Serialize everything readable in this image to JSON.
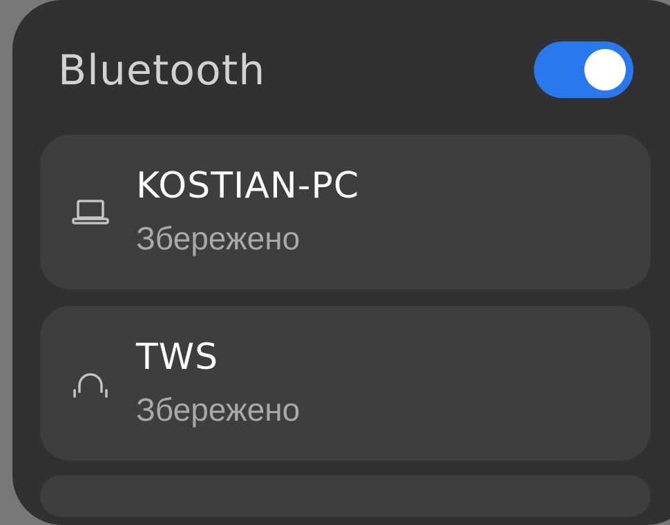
{
  "header": {
    "title": "Bluetooth",
    "toggle_state": "on",
    "toggle_color": "#2a78f0"
  },
  "devices": [
    {
      "name": "KOSTIAN-PC",
      "status": "Збережено",
      "icon": "laptop-icon"
    },
    {
      "name": "TWS",
      "status": "Збережено",
      "icon": "headphones-icon"
    }
  ]
}
